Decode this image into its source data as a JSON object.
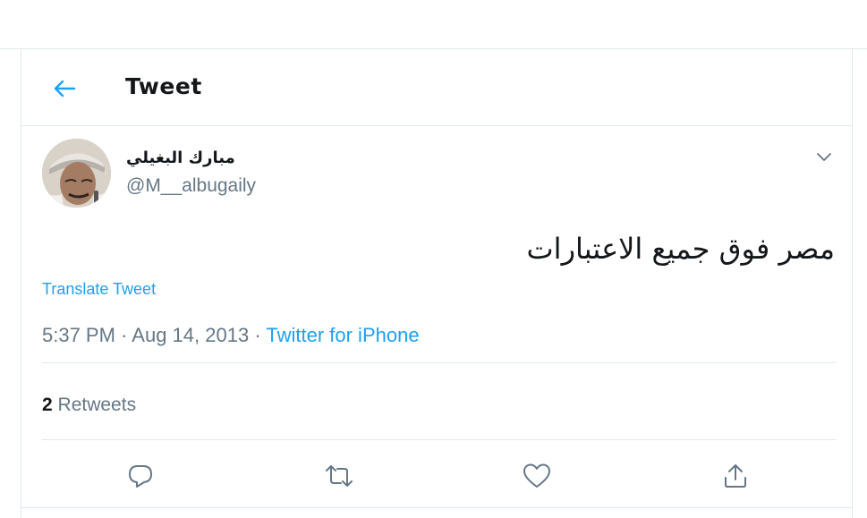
{
  "header": {
    "title": "Tweet",
    "back_icon": "arrow-left-icon"
  },
  "tweet": {
    "author_name": "مبارك البغيلي",
    "author_handle": "@M__albugaily",
    "text": "مصر فوق جميع الاعتبارات",
    "translate_label": "Translate Tweet",
    "time": "5:37 PM",
    "separator": "·",
    "date": "Aug 14, 2013",
    "source": "Twitter for iPhone",
    "retweet_count": "2",
    "retweets_label": "Retweets"
  },
  "actions": [
    {
      "name": "reply",
      "icon": "reply-icon"
    },
    {
      "name": "retweet",
      "icon": "retweet-icon"
    },
    {
      "name": "like",
      "icon": "heart-icon"
    },
    {
      "name": "share",
      "icon": "share-icon"
    }
  ],
  "colors": {
    "accent": "#1da1f2",
    "text": "#14171a",
    "secondary": "#657786",
    "border": "#e1e8ed",
    "icon": "#657786"
  }
}
